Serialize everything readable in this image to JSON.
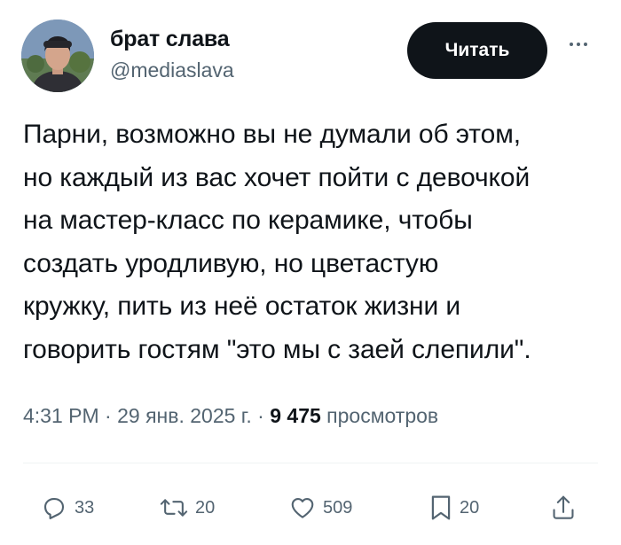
{
  "author": {
    "display_name": "брат слава",
    "handle": "@mediaslava",
    "avatar_icon": "user-avatar-photo"
  },
  "header": {
    "read_button_label": "Читать",
    "more_icon": "more-horizontal-icon"
  },
  "tweet": {
    "lines": [
      "Парни, возможно вы не думали об этом,",
      "но каждый из вас хочет пойти с девочкой",
      "на мастер-класс по керамике, чтобы",
      "создать уродливую, но цветастую",
      "кружку, пить из неё остаток жизни и",
      "говорить гостям \"это мы с заей слепили\"."
    ]
  },
  "meta": {
    "time": "4:31 PM",
    "separator": "·",
    "date": "29 янв. 2025 г.",
    "views_count": "9 475",
    "views_label": "просмотров"
  },
  "actions": {
    "replies": "33",
    "reposts": "20",
    "likes": "509",
    "bookmarks": "20"
  },
  "colors": {
    "text_primary": "#0f1419",
    "text_secondary": "#536471",
    "button_bg": "#0f1419",
    "divider": "#eff3f4"
  }
}
